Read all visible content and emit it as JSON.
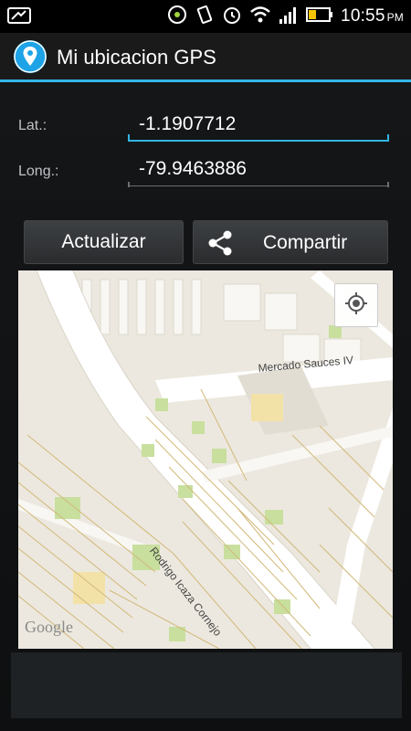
{
  "status_bar": {
    "time": "10:55",
    "ampm": "PM",
    "icons": [
      "notification-icon",
      "sync-icon",
      "vibrate-icon",
      "alarm-icon",
      "wifi-icon",
      "signal-icon",
      "battery-icon"
    ]
  },
  "app": {
    "title": "Mi ubicacion GPS",
    "icon": "location-pin-icon",
    "accent_color": "#33b5e5"
  },
  "form": {
    "lat_label": "Lat.:",
    "lat_value": "-1.1907712",
    "long_label": "Long.:",
    "long_value": "-79.9463886"
  },
  "buttons": {
    "update_label": "Actualizar",
    "share_label": "Compartir",
    "share_icon": "share-icon"
  },
  "map": {
    "street_mercado": "Mercado Sauces IV",
    "street_rodrigo": "Rodrigo Icaza Cornejo",
    "provider": "Google",
    "locate_icon": "my-location-icon"
  }
}
